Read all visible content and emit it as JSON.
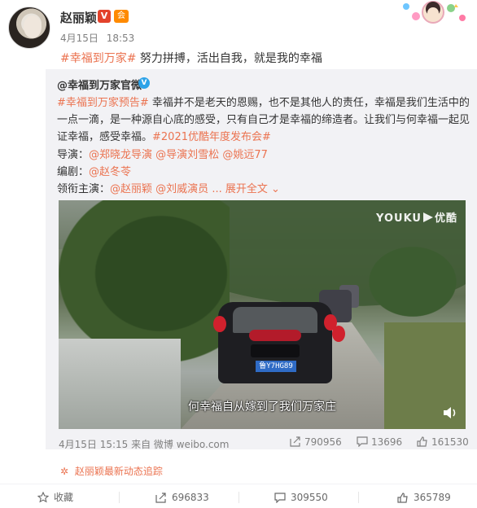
{
  "post": {
    "username": "赵丽颖",
    "verify_badge": "V",
    "member_badge": "会",
    "date": "4月15日",
    "time": "18:53",
    "hashtag": "#幸福到万家#",
    "text": " 努力拼搏，活出自我，就是我的幸福"
  },
  "repost": {
    "author": "@幸福到万家官微",
    "hashtag": "#幸福到万家预告#",
    "body": " 幸福并不是老天的恩赐，也不是其他人的责任，幸福是我们生活中的一点一滴，是一种源自心底的感受，只有自己才是幸福的缔造者。让我们与何幸福一起见证幸福，感受幸福。",
    "event_tag": "#2021优酷年度发布会#",
    "director_label": "导演：",
    "directors": [
      "@郑晓龙导演",
      "@导演刘雪松",
      "@姚远77"
    ],
    "writer_label": "编剧：",
    "writer": "@赵冬苓",
    "cast_label": "领衔主演：",
    "cast": [
      "@赵丽颖",
      "@刘威演员"
    ],
    "more": "... 展开全文",
    "video": {
      "brand": "YOUKU",
      "brand_cn": "优酷",
      "subtitle": "何幸福自从嫁到了我们万家庄",
      "plate": "鲁Y7HG89"
    },
    "footer_time": "4月15日 15:15 来自 微博 weibo.com",
    "stats": {
      "reposts": "790956",
      "comments": "13696",
      "likes": "161530"
    }
  },
  "track_text": "赵丽颖最新动态追踪",
  "actions": {
    "favorite": "收藏",
    "repost": "696833",
    "comment": "309550",
    "like": "365789"
  },
  "colors": {
    "link": "#eb7350",
    "repost_bg": "#f2f2f5",
    "meta": "#808080"
  }
}
